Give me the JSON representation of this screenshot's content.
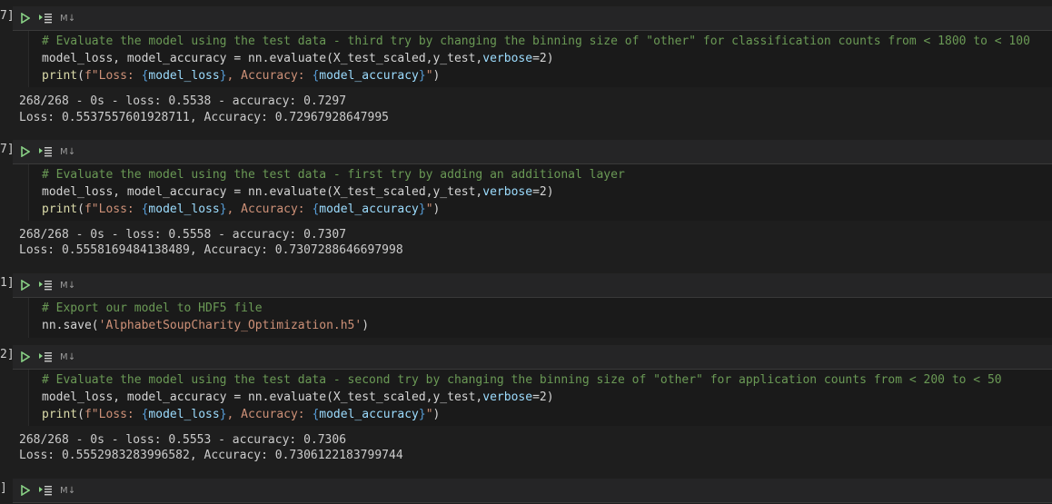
{
  "cells": [
    {
      "exec_count": "7]",
      "markdown_label": "M↓",
      "code": {
        "line1": "# Evaluate the model using the test data - third try by changing the binning size of \"other\" for classification counts from < 1800 to < 100",
        "line2": {
          "a": "model_loss, model_accuracy = nn.evaluate(X_test_scaled,y_test,",
          "kw": "verbose",
          "b": "=2)"
        },
        "line3": {
          "fn": "print",
          "p1": "(",
          "s1": "f\"Loss: ",
          "b1": "{",
          "v1": "model_loss",
          "b2": "}",
          "s2": ", Accuracy: ",
          "b3": "{",
          "v2": "model_accuracy",
          "b4": "}",
          "s3": "\"",
          "p2": ")"
        }
      },
      "output": [
        "268/268 - 0s - loss: 0.5538 - accuracy: 0.7297",
        "Loss: 0.5537557601928711, Accuracy: 0.72967928647995"
      ]
    },
    {
      "exec_count": "7]",
      "markdown_label": "M↓",
      "code": {
        "line1": "# Evaluate the model using the test data - first try by adding an additional layer",
        "line2": {
          "a": "model_loss, model_accuracy = nn.evaluate(X_test_scaled,y_test,",
          "kw": "verbose",
          "b": "=2)"
        },
        "line3": {
          "fn": "print",
          "p1": "(",
          "s1": "f\"Loss: ",
          "b1": "{",
          "v1": "model_loss",
          "b2": "}",
          "s2": ", Accuracy: ",
          "b3": "{",
          "v2": "model_accuracy",
          "b4": "}",
          "s3": "\"",
          "p2": ")"
        }
      },
      "output": [
        "268/268 - 0s - loss: 0.5558 - accuracy: 0.7307",
        "Loss: 0.5558169484138489, Accuracy: 0.7307288646697998"
      ]
    },
    {
      "exec_count": "1]",
      "markdown_label": "M↓",
      "code": {
        "line1": "# Export our model to HDF5 file",
        "line2": {
          "a": "nn.save(",
          "str": "'AlphabetSoupCharity_Optimization.h5'",
          "b": ")"
        }
      }
    },
    {
      "exec_count": "2]",
      "markdown_label": "M↓",
      "code": {
        "line1": "# Evaluate the model using the test data - second try by changing the binning size of \"other\" for application counts from < 200 to < 50",
        "line2": {
          "a": "model_loss, model_accuracy = nn.evaluate(X_test_scaled,y_test,",
          "kw": "verbose",
          "b": "=2)"
        },
        "line3": {
          "fn": "print",
          "p1": "(",
          "s1": "f\"Loss: ",
          "b1": "{",
          "v1": "model_loss",
          "b2": "}",
          "s2": ", Accuracy: ",
          "b3": "{",
          "v2": "model_accuracy",
          "b4": "}",
          "s3": "\"",
          "p2": ")"
        }
      },
      "output": [
        "268/268 - 0s - loss: 0.5553 - accuracy: 0.7306",
        "Loss: 0.5552983283996582, Accuracy: 0.7306122183799744"
      ]
    },
    {
      "exec_count": "]",
      "markdown_label": "M↓"
    }
  ],
  "icons": {
    "run": "run-cell-icon",
    "run_by_line": "run-by-line-icon"
  },
  "colors": {
    "background": "#1e1e1e",
    "toolbar": "#252526",
    "run_green": "#89d185",
    "comment": "#6a9955",
    "string": "#ce9178",
    "function": "#dcdcaa",
    "keyword": "#569cd6",
    "variable": "#9cdcfe"
  }
}
